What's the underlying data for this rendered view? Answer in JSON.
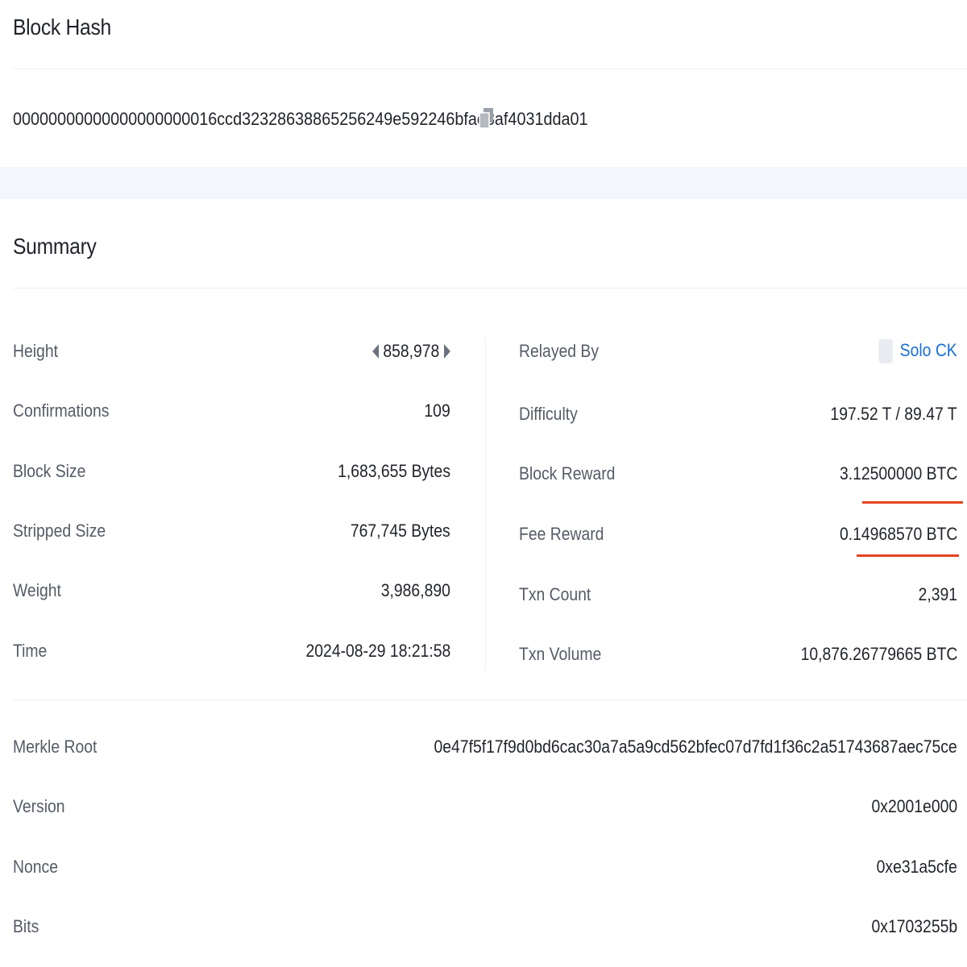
{
  "block_hash": {
    "title": "Block Hash",
    "value": "00000000000000000000016ccd32328638865256249e592246bfae8af4031dda01",
    "copy_icon": "copy-icon"
  },
  "summary": {
    "title": "Summary",
    "left": [
      {
        "label": "Height",
        "value": "858,978"
      },
      {
        "label": "Confirmations",
        "value": "109"
      },
      {
        "label": "Block Size",
        "value": "1,683,655 Bytes"
      },
      {
        "label": "Stripped Size",
        "value": "767,745 Bytes"
      },
      {
        "label": "Weight",
        "value": "3,986,890"
      },
      {
        "label": "Time",
        "value": "2024-08-29 18:21:58"
      }
    ],
    "right": [
      {
        "label": "Relayed By",
        "value": "Solo CK"
      },
      {
        "label": "Difficulty",
        "value": "197.52 T / 89.47 T"
      },
      {
        "label": "Block Reward",
        "value": "3.12500000 BTC"
      },
      {
        "label": "Fee Reward",
        "value": "0.14968570 BTC"
      },
      {
        "label": "Txn Count",
        "value": "2,391"
      },
      {
        "label": "Txn Volume",
        "value": "10,876.26779665 BTC"
      }
    ],
    "full": [
      {
        "label": "Merkle Root",
        "value": "0e47f5f17f9d0bd6cac30a7a5a9cd562bfec07d7fd1f36c2a51743687aec75ce"
      },
      {
        "label": "Version",
        "value": "0x2001e000"
      },
      {
        "label": "Nonce",
        "value": "0xe31a5cfe"
      },
      {
        "label": "Bits",
        "value": "0x1703255b"
      }
    ]
  },
  "colors": {
    "link": "#1a6fd8",
    "highlight_underline": "#e8431f",
    "band": "#f3f7fc"
  }
}
